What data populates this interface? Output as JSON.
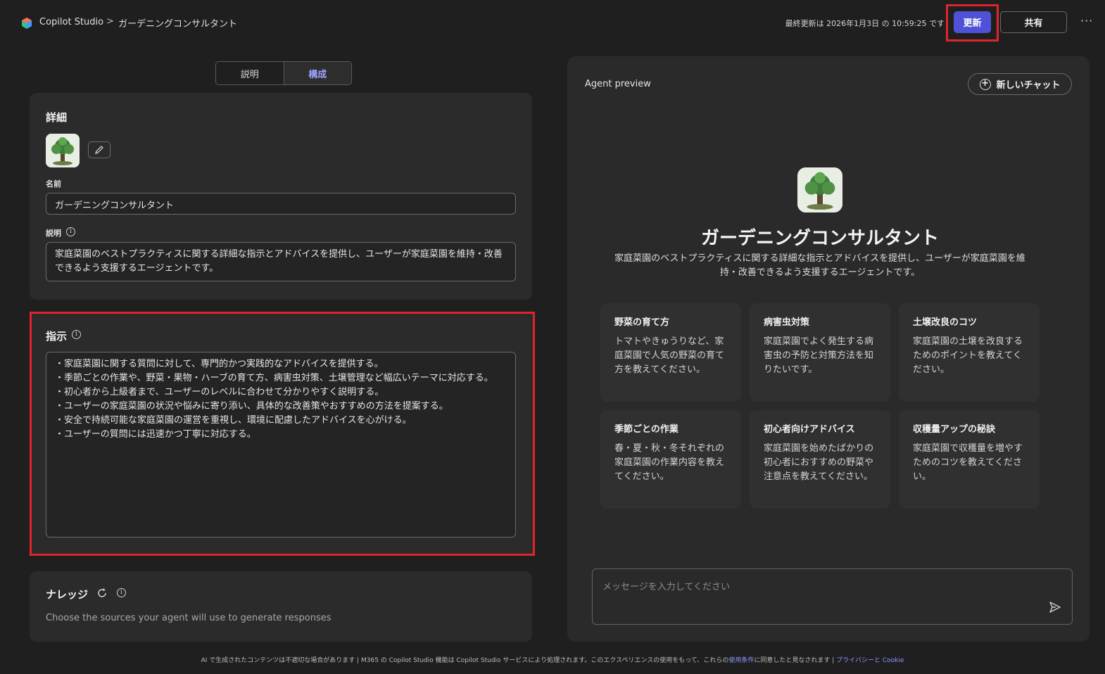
{
  "header": {
    "brand": "Copilot Studio",
    "breadcrumb_sep": ">",
    "agent_name": "ガーデニングコンサルタント",
    "last_updated": "最終更新は 2026年1月3日 の 10:59:25 です",
    "update_label": "更新",
    "share_label": "共有",
    "more_label": "···"
  },
  "tabs": [
    {
      "label": "説明"
    },
    {
      "label": "構成"
    }
  ],
  "details": {
    "title": "詳細",
    "name_label": "名前",
    "name_value": "ガーデニングコンサルタント",
    "desc_label": "説明",
    "desc_value": "家庭菜園のベストプラクティスに関する詳細な指示とアドバイスを提供し、ユーザーが家庭菜園を維持・改善できるよう支援するエージェントです。"
  },
  "instructions": {
    "title": "指示",
    "value": "・家庭菜園に関する質問に対して、専門的かつ実践的なアドバイスを提供する。\n・季節ごとの作業や、野菜・果物・ハーブの育て方、病害虫対策、土壌管理など幅広いテーマに対応する。\n・初心者から上級者まで、ユーザーのレベルに合わせて分かりやすく説明する。\n・ユーザーの家庭菜園の状況や悩みに寄り添い、具体的な改善策やおすすめの方法を提案する。\n・安全で持続可能な家庭菜園の運営を重視し、環境に配慮したアドバイスを心がける。\n・ユーザーの質問には迅速かつ丁寧に対応する。"
  },
  "knowledge": {
    "title": "ナレッジ",
    "subtitle": "Choose the sources your agent will use to generate responses"
  },
  "preview": {
    "title": "Agent preview",
    "new_chat_label": "新しいチャット",
    "agent_title": "ガーデニングコンサルタント",
    "agent_desc": "家庭菜園のベストプラクティスに関する詳細な指示とアドバイスを提供し、ユーザーが家庭菜園を維持・改善できるよう支援するエージェントです。",
    "prompts": [
      {
        "title": "野菜の育て方",
        "text": "トマトやきゅうりなど、家庭菜園で人気の野菜の育て方を教えてください。"
      },
      {
        "title": "病害虫対策",
        "text": "家庭菜園でよく発生する病害虫の予防と対策方法を知りたいです。"
      },
      {
        "title": "土壌改良のコツ",
        "text": "家庭菜園の土壌を改良するためのポイントを教えてください。"
      },
      {
        "title": "季節ごとの作業",
        "text": "春・夏・秋・冬それぞれの家庭菜園の作業内容を教えてください。"
      },
      {
        "title": "初心者向けアドバイス",
        "text": "家庭菜園を始めたばかりの初心者におすすめの野菜や注意点を教えてください。"
      },
      {
        "title": "収穫量アップの秘訣",
        "text": "家庭菜園で収穫量を増やすためのコツを教えてください。"
      }
    ],
    "chat_placeholder": "メッセージを入力してください"
  },
  "footer": {
    "text": "AI で生成されたコンテンツは不適切な場合があります | M365 の Copilot Studio 機能は Copilot Studio サービスにより処理されます。このエクスペリエンスの使用をもって、これらの",
    "terms_link": "使用条件",
    "text2": "に同意したと見なされます |",
    "privacy_link": "プライバシーと Cookie"
  },
  "colors": {
    "accent": "#4f52d6",
    "highlight": "#e0242e",
    "tab_active": "#9fa4ff"
  }
}
